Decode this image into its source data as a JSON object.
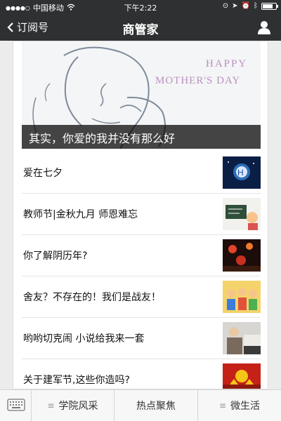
{
  "status_bar": {
    "carrier": "中国移动",
    "time": "下午2:22"
  },
  "nav": {
    "back_label": "订阅号",
    "title": "商管家"
  },
  "hero": {
    "image_text_line1": "HAPPY",
    "image_text_line2": "MOTHER'S DAY",
    "caption": "其实，你爱的我并没有那么好"
  },
  "articles": [
    {
      "title": "爱在七夕"
    },
    {
      "title": "教师节|金秋九月 师恩难忘"
    },
    {
      "title": "你了解阴历年?"
    },
    {
      "title": "舍友？不存在的！我们是战友！"
    },
    {
      "title": "哟哟切克闹 小说给我来一套"
    },
    {
      "title": "关于建军节,这些你造吗?"
    }
  ],
  "tabbar": {
    "tabs": [
      {
        "label": "学院风采"
      },
      {
        "label": "热点聚焦"
      },
      {
        "label": "微生活"
      }
    ]
  },
  "colors": {
    "nav_bg": "#2e3032",
    "caption_bg": "#000000",
    "tab_bg": "#f7f7f7"
  }
}
